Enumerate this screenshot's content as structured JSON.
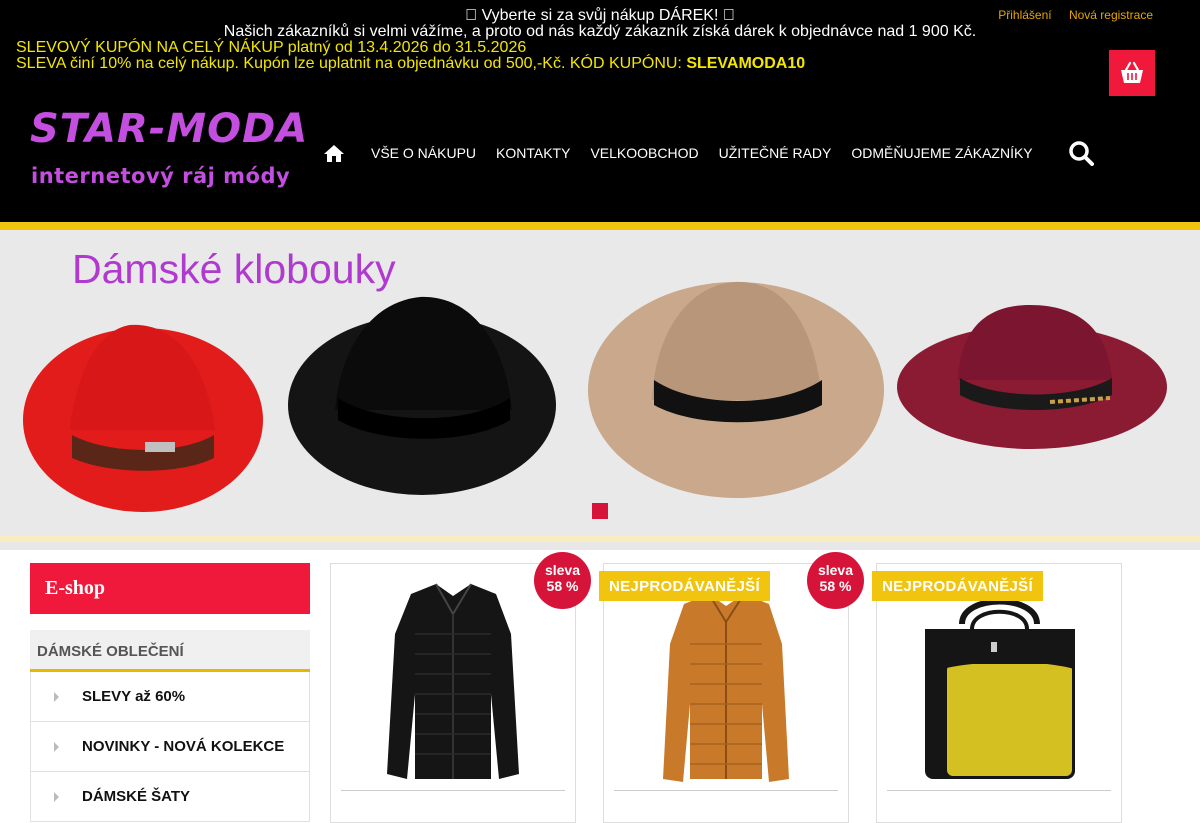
{
  "topbar": {
    "gift_text": "\u0000 Vyberte si za svůj nákup DÁREK! \u0000",
    "customer_text": "Našich zákazníků si velmi vážíme, a proto od nás každý zákazník získá dárek k objednávce nad 1 900 Kč.",
    "login_label": "Přihlášení",
    "register_label": "Nová registrace",
    "coupon_line1": "SLEVOVÝ KUPÓN NA CELÝ NÁKUP platný od 13.4.2026 do 31.5.2026",
    "coupon_line2_prefix": "SLEVA činí 10% na celý nákup. Kupón lze uplatnit na objednávku od 500,-Kč. KÓD KUPÓNU: ",
    "coupon_code": "SLEVAMODA10"
  },
  "logo": {
    "title": "STAR-MODA",
    "subtitle": "internetový ráj módy"
  },
  "nav": {
    "items": [
      "VŠE O NÁKUPU",
      "KONTAKTY",
      "VELKOOBCHOD",
      "UŽITEČNÉ RADY",
      "ODMĚŇUJEME ZÁKAZNÍKY"
    ]
  },
  "banner": {
    "title": "Dámské klobouky",
    "hat_colors": [
      "#e21b1b",
      "#141414",
      "#c9a88b",
      "#8b1a33"
    ]
  },
  "sidebar": {
    "eshop_label": "E-shop",
    "category_heading": "DÁMSKÉ OBLEČENÍ",
    "items": [
      "SLEVY až 60%",
      "NOVINKY - NOVÁ KOLEKCE",
      "DÁMSKÉ ŠATY"
    ]
  },
  "products": [
    {
      "sale_label": "sleva",
      "sale_value": "58 %",
      "badge": ""
    },
    {
      "sale_label": "sleva",
      "sale_value": "58 %",
      "badge": "NEJPRODÁVANĚJŠÍ"
    },
    {
      "sale_label": "",
      "sale_value": "",
      "badge": "NEJPRODÁVANĚJŠÍ"
    }
  ],
  "colors": {
    "accent_red": "#f0193c",
    "accent_yellow": "#f1c40f",
    "logo_purple": "#c44ee0"
  }
}
